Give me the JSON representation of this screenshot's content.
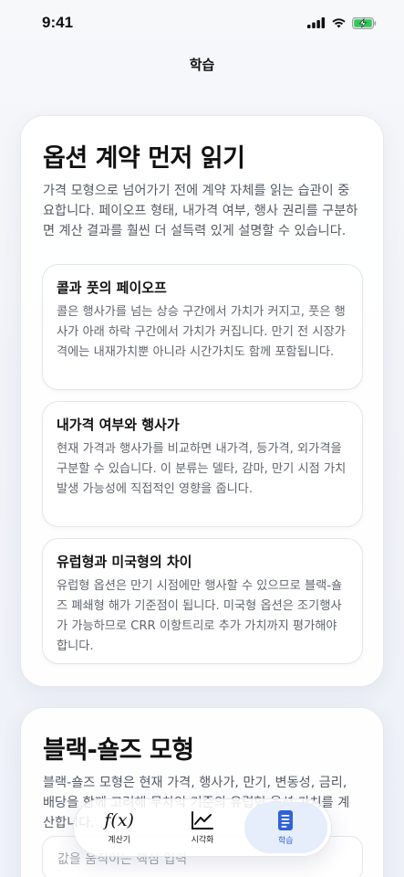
{
  "status_bar": {
    "time": "9:41"
  },
  "header": {
    "title": "학습"
  },
  "card1": {
    "title": "옵션 계약 먼저 읽기",
    "description": "가격 모형으로 넘어가기 전에 계약 자체를 읽는 습관이 중요합니다. 페이오프 형태, 내가격 여부, 행사 권리를 구분하면 계산 결과를 훨씬 더 설득력 있게 설명할 수 있습니다.",
    "items": [
      {
        "title": "콜과 풋의 페이오프",
        "body": "콜은 행사가를 넘는 상승 구간에서 가치가 커지고, 풋은 행사가 아래 하락 구간에서 가치가 커집니다. 만기 전 시장가격에는 내재가치뿐 아니라 시간가치도 함께 포함됩니다."
      },
      {
        "title": "내가격 여부와 행사가",
        "body": "현재 가격과 행사가를 비교하면 내가격, 등가격, 외가격을 구분할 수 있습니다. 이 분류는 델타, 감마, 만기 시점 가치 발생 가능성에 직접적인 영향을 줍니다."
      },
      {
        "title": "유럽형과 미국형의 차이",
        "body": "유럽형 옵션은 만기 시점에만 행사할 수 있으므로 블랙-숄즈 폐쇄형 해가 기준점이 됩니다. 미국형 옵션은 조기행사가 가능하므로 CRR 이항트리로 추가 가치까지 평가해야 합니다."
      }
    ]
  },
  "card2": {
    "title": "블랙-숄즈 모형",
    "description": "블랙-숄즈 모형은 현재 가격, 행사가, 만기, 변동성, 금리, 배당을 함께 고려해 무차익 기준의 유럽형 옵션 가치를 계산합니다.",
    "input_hint": "값을 움직이는 핵심 입력"
  },
  "tab_bar": {
    "tabs": [
      {
        "label": "계산기",
        "icon": "function-icon",
        "active": false
      },
      {
        "label": "시각화",
        "icon": "chart-icon",
        "active": false
      },
      {
        "label": "학습",
        "icon": "document-icon",
        "active": true
      }
    ],
    "accent": "#2f62d8"
  }
}
